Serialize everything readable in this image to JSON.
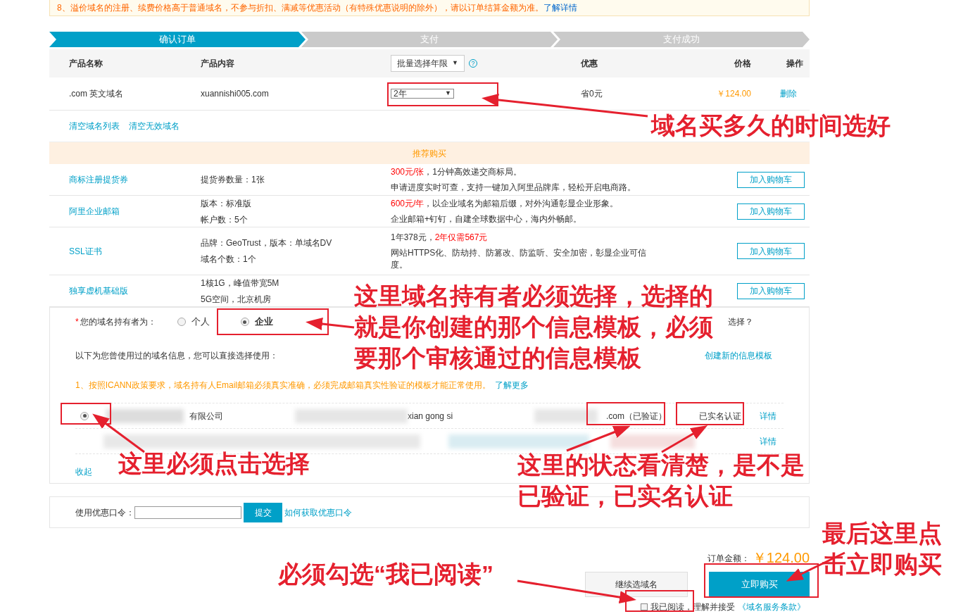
{
  "notice": {
    "text": "8、溢价域名的注册、续费价格高于普通域名，不参与折扣、满减等优惠活动（有特殊优惠说明的除外），请以订单结算金额为准。",
    "link": "了解详情"
  },
  "steps": [
    {
      "label": "确认订单",
      "selected": true
    },
    {
      "label": "支付",
      "selected": false
    },
    {
      "label": "支付成功",
      "selected": false
    }
  ],
  "order_table": {
    "columns": [
      "产品名称",
      "产品内容",
      "优惠",
      "价格",
      "操作"
    ],
    "batch_select": "批量选择年限",
    "batch_caret": "▼",
    "help_icon": "?",
    "rows": [
      {
        "name": ".com 英文域名",
        "content": "xuannishi005.com",
        "period": "2年",
        "period_caret": "▼",
        "discount": "省0元",
        "price": "￥124.00",
        "action": "删除"
      }
    ]
  },
  "list_links": [
    "清空域名列表",
    "清空无效域名"
  ],
  "recommend": {
    "title": "推荐购买",
    "rows": [
      {
        "name": "商标注册提货券",
        "specs": [
          "提货券数量：1张"
        ],
        "button": "加入购物车",
        "desc": [
          [
            {
              "text": "300元/张",
              "red": true
            },
            {
              "text": "，1分钟高效递交商标局。",
              "red": false
            }
          ],
          [
            {
              "text": "申请进度实时可查，支持一键加入阿里品牌库，轻松开启电商路。",
              "red": false
            }
          ]
        ]
      },
      {
        "name": "阿里企业邮箱",
        "specs": [
          "版本：标准版",
          "帐户数：5个"
        ],
        "button": "加入购物车",
        "desc": [
          [
            {
              "text": "600元/年",
              "red": true
            },
            {
              "text": "，以企业域名为邮箱后缀，对外沟通彰显企业形象。",
              "red": false
            }
          ],
          [
            {
              "text": "企业邮箱+钉钉，自建全球数据中心，海内外畅邮。",
              "red": false
            }
          ]
        ]
      },
      {
        "name": "SSL证书",
        "specs": [
          "品牌：GeoTrust，版本：单域名DV",
          "域名个数：1个"
        ],
        "button": "加入购物车",
        "desc": [
          [
            {
              "text": "1年378元，",
              "red": false
            },
            {
              "text": "2年仅需567元",
              "red": true
            }
          ],
          [
            {
              "text": "网站HTTPS化、防劫持、防篡改、防监听、安全加密，彰显企业可信度。",
              "red": false
            }
          ]
        ]
      },
      {
        "name": "独享虚机基础版",
        "specs": [
          "1核1G，峰值带宽5M",
          "5G空间，北京机房"
        ],
        "button": "加入购物车",
        "desc": []
      }
    ]
  },
  "owner": {
    "required": "*",
    "label": "您的域名持有者为：",
    "options": [
      {
        "label": "个人",
        "selected": false
      },
      {
        "label": "企业",
        "selected": true
      }
    ],
    "help": "选择？",
    "intro": "以下为您曾使用过的域名信息，您可以直接选择使用：",
    "create_link": "创建新的信息模板",
    "warning": "1、按照ICANN政策要求，域名持有人Email邮箱必须真实准确，必须完成邮箱真实性验证的模板才能正常使用。",
    "learn_more": "了解更多",
    "templates": [
      {
        "selected": true,
        "name": "有限公司",
        "pinyin": "xian gong si",
        "email": ".com（已验证）",
        "status": "已实名认证",
        "link": "详情"
      },
      {
        "link": "详情"
      }
    ],
    "collapse": "收起"
  },
  "coupon": {
    "label": "使用优惠口令：",
    "submit": "提交",
    "help": "如何获取优惠口令"
  },
  "checkout": {
    "total_label": "订单金额：",
    "total": "￥124.00",
    "continue": "继续选域名",
    "buy": "立即购买",
    "agree_checked": false,
    "agree": "我已阅读，理解并接受",
    "terms": "《域名服务条款》"
  },
  "annotations": [
    {
      "kind": "period",
      "lines": [
        "域名买多久的时间选好"
      ]
    },
    {
      "kind": "owner",
      "lines": [
        "这里域名持有者必须选择，选择的",
        "就是你创建的那个信息模板，必须",
        "要那个审核通过的信息模板"
      ]
    },
    {
      "kind": "template",
      "lines": [
        "这里必须点击选择"
      ]
    },
    {
      "kind": "status",
      "lines": [
        "这里的状态看清楚，是不是",
        "已验证，已实名认证"
      ]
    },
    {
      "kind": "agree",
      "lines": [
        "必须勾选“我已阅读”"
      ]
    },
    {
      "kind": "buy",
      "lines": [
        "最后这里点",
        "击立即购买"
      ]
    }
  ]
}
